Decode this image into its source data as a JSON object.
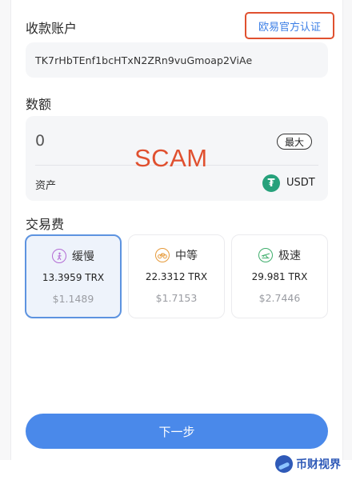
{
  "account": {
    "label": "收款账户",
    "verify_link": "欧易官方认证",
    "address": "TK7rHbTEnf1bcHTxN2ZRn9vuGmoap2ViAe"
  },
  "amount": {
    "label": "数额",
    "value": "0",
    "max_label": "最大",
    "asset_label": "资产",
    "asset_name": "USDT",
    "asset_icon": "tether-icon"
  },
  "overlay": {
    "scam_text": "SCAM"
  },
  "fee": {
    "label": "交易费",
    "options": [
      {
        "name": "缓慢",
        "trx": "13.3959 TRX",
        "usd": "$1.1489",
        "icon": "walker-icon",
        "selected": true
      },
      {
        "name": "中等",
        "trx": "22.3312 TRX",
        "usd": "$1.7153",
        "icon": "bicycle-icon",
        "selected": false
      },
      {
        "name": "极速",
        "trx": "29.981 TRX",
        "usd": "$2.7446",
        "icon": "airplane-icon",
        "selected": false
      }
    ]
  },
  "actions": {
    "next_label": "下一步"
  },
  "watermark": {
    "text": "币财视界"
  },
  "colors": {
    "accent": "#4a89ea",
    "warning": "#e0502f",
    "link": "#3a7ee6"
  }
}
